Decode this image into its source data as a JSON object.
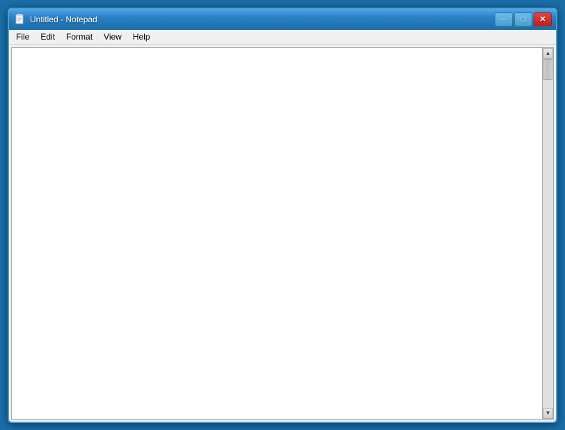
{
  "window": {
    "title": "Untitled - Notepad",
    "icon": "notepad-icon"
  },
  "titlebar": {
    "controls": {
      "minimize_label": "─",
      "maximize_label": "□",
      "close_label": "✕"
    }
  },
  "menubar": {
    "items": [
      {
        "id": "file",
        "label": "File"
      },
      {
        "id": "edit",
        "label": "Edit"
      },
      {
        "id": "format",
        "label": "Format"
      },
      {
        "id": "view",
        "label": "View"
      },
      {
        "id": "help",
        "label": "Help"
      }
    ]
  },
  "editor": {
    "content": "",
    "placeholder": ""
  },
  "scrollbar": {
    "up_arrow": "▲",
    "down_arrow": "▼",
    "left_arrow": "◀",
    "right_arrow": "▶"
  }
}
